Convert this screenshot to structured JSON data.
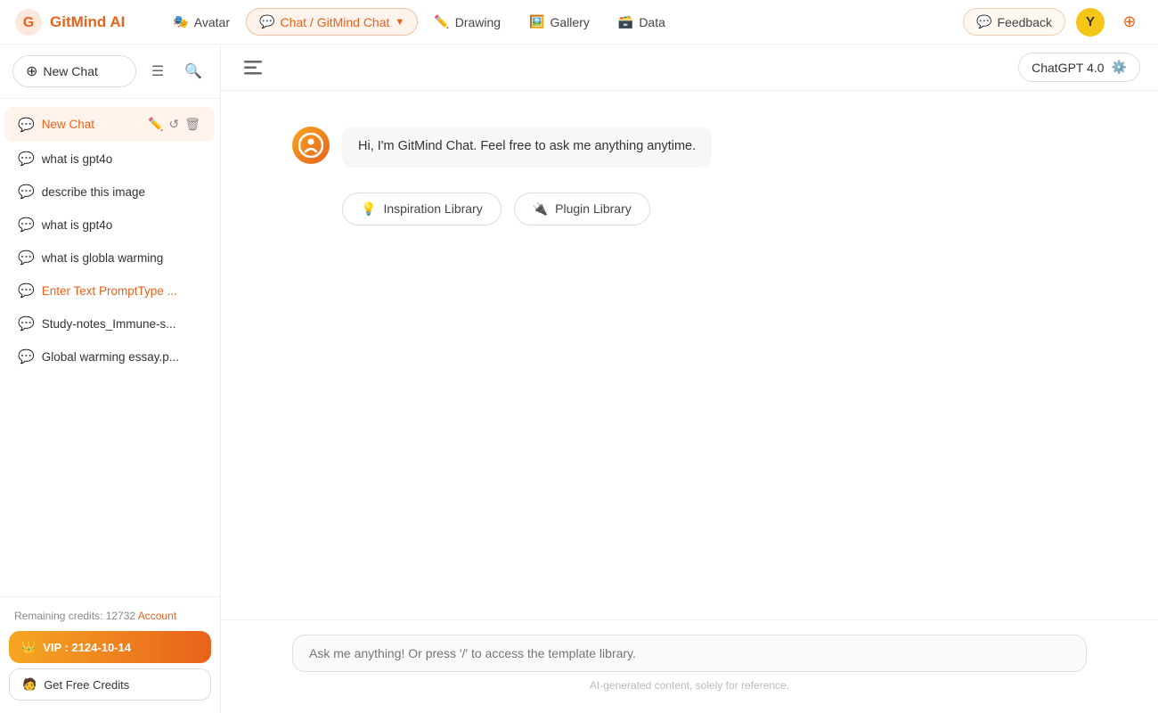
{
  "app": {
    "name": "GitMind AI"
  },
  "topNav": {
    "logoText": "GitMind AI",
    "items": [
      {
        "id": "avatar",
        "label": "Avatar",
        "icon": "🎭",
        "active": false
      },
      {
        "id": "chat",
        "label": "Chat / GitMind Chat",
        "icon": "💬",
        "active": true
      },
      {
        "id": "drawing",
        "label": "Drawing",
        "icon": "✏️",
        "active": false
      },
      {
        "id": "gallery",
        "label": "Gallery",
        "icon": "🖼️",
        "active": false
      },
      {
        "id": "data",
        "label": "Data",
        "icon": "🗃️",
        "active": false
      }
    ],
    "feedbackLabel": "Feedback",
    "modelSelector": {
      "label": "ChatGPT 4.0",
      "icon": "⚙️"
    }
  },
  "sidebar": {
    "newChatLabel": "New Chat",
    "chatHistory": [
      {
        "id": "new-chat",
        "label": "New Chat",
        "active": true
      },
      {
        "id": "gpt4o-1",
        "label": "what is gpt4o",
        "active": false
      },
      {
        "id": "describe-image",
        "label": "describe this image",
        "active": false
      },
      {
        "id": "gpt4o-2",
        "label": "what is gpt4o",
        "active": false
      },
      {
        "id": "global-warming",
        "label": "what is globla warming",
        "active": false
      },
      {
        "id": "prompt-type",
        "label": "Enter Text PromptType ...",
        "active": false,
        "highlight": true
      },
      {
        "id": "study-notes",
        "label": "Study-notes_Immune-s...",
        "active": false
      },
      {
        "id": "warming-essay",
        "label": "Global warming essay.p...",
        "active": false
      }
    ],
    "credits": {
      "text": "Remaining credits: 12732",
      "linkLabel": "Account"
    },
    "vipLabel": "VIP : 2124-10-14",
    "freeCreditsLabel": "Get Free Credits"
  },
  "chat": {
    "greeting": "Hi, I'm GitMind Chat. Feel free to ask me anything anytime.",
    "inspirationLibraryLabel": "Inspiration Library",
    "pluginLibraryLabel": "Plugin Library",
    "inputPlaceholder": "Ask me anything! Or press '/' to access the template library.",
    "footerNote": "AI-generated content, solely for reference."
  }
}
